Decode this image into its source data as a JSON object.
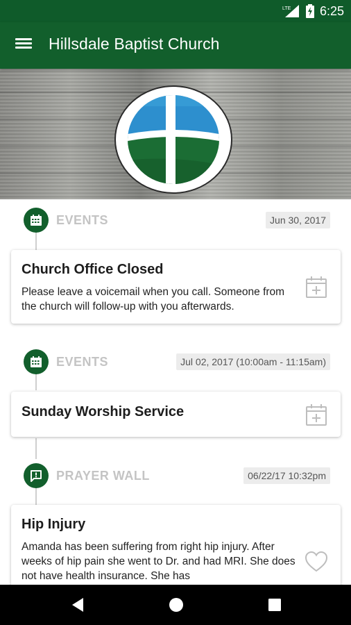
{
  "status_bar": {
    "network": "LTE",
    "time": "6:25"
  },
  "app_bar": {
    "title": "Hillsdale Baptist Church",
    "menu_icon": "hamburger-menu-icon"
  },
  "colors": {
    "primary": "#125f2c",
    "category_text": "#c4c4c4",
    "date_pill_bg": "#ececec",
    "logo_sky": "#2d8fce",
    "logo_grass": "#1b6d34"
  },
  "feed": [
    {
      "category": "EVENTS",
      "category_icon": "calendar-icon",
      "date": "Jun 30, 2017",
      "title": "Church Office Closed",
      "body": "Please leave a voicemail when you call. Someone from the church will follow-up with you afterwards.",
      "action_icon": "add-to-calendar-icon"
    },
    {
      "category": "EVENTS",
      "category_icon": "calendar-icon",
      "date": "Jul 02, 2017 (10:00am - 11:15am)",
      "title": "Sunday Worship Service",
      "body": "",
      "action_icon": "add-to-calendar-icon"
    },
    {
      "category": "PRAYER WALL",
      "category_icon": "prayer-chat-icon",
      "date": "06/22/17 10:32pm",
      "title": "Hip Injury",
      "body": "Amanda has been suffering from  right hip injury. After weeks of hip pain she went to Dr. and had MRI.  She does not have health insurance. She has",
      "action_icon": "heart-icon"
    }
  ],
  "nav_bar": {
    "back_icon": "back-triangle-icon",
    "home_icon": "home-circle-icon",
    "recents_icon": "recents-square-icon"
  }
}
